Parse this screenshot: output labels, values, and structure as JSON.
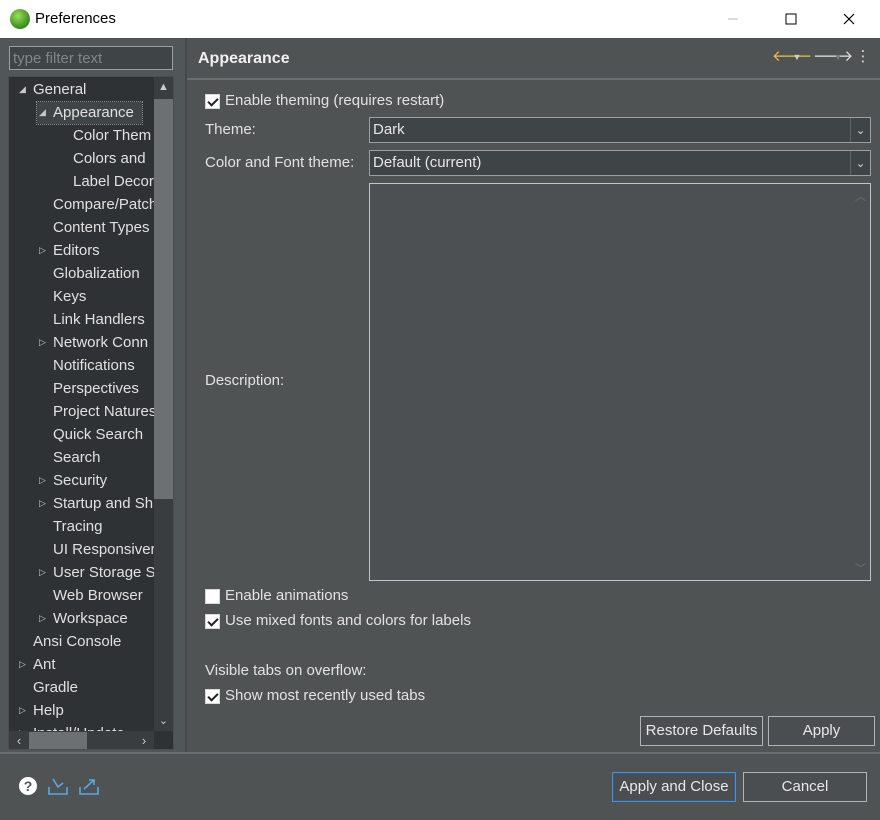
{
  "window": {
    "title": "Preferences",
    "minimize_icon": "minimize-icon",
    "maximize_icon": "maximize-icon",
    "close_icon": "close-icon"
  },
  "filter": {
    "placeholder": "type filter text",
    "value": ""
  },
  "tree": {
    "items": [
      {
        "label": "General",
        "level": 0,
        "expanded": true
      },
      {
        "label": "Appearance",
        "level": 1,
        "expanded": true,
        "selected": true
      },
      {
        "label": "Color Them",
        "level": 2
      },
      {
        "label": "Colors and",
        "level": 2
      },
      {
        "label": "Label Decor",
        "level": 2
      },
      {
        "label": "Compare/Patch",
        "level": 1
      },
      {
        "label": "Content Types",
        "level": 1
      },
      {
        "label": "Editors",
        "level": 1,
        "collapsed": true
      },
      {
        "label": "Globalization",
        "level": 1
      },
      {
        "label": "Keys",
        "level": 1
      },
      {
        "label": "Link Handlers",
        "level": 1
      },
      {
        "label": "Network Conn",
        "level": 1,
        "collapsed": true
      },
      {
        "label": "Notifications",
        "level": 1
      },
      {
        "label": "Perspectives",
        "level": 1
      },
      {
        "label": "Project Natures",
        "level": 1
      },
      {
        "label": "Quick Search",
        "level": 1
      },
      {
        "label": "Search",
        "level": 1
      },
      {
        "label": "Security",
        "level": 1,
        "collapsed": true
      },
      {
        "label": "Startup and Sh",
        "level": 1,
        "collapsed": true
      },
      {
        "label": "Tracing",
        "level": 1
      },
      {
        "label": "UI Responsiver",
        "level": 1
      },
      {
        "label": "User Storage S",
        "level": 1,
        "collapsed": true
      },
      {
        "label": "Web Browser",
        "level": 1
      },
      {
        "label": "Workspace",
        "level": 1,
        "collapsed": true
      },
      {
        "label": "Ansi Console",
        "level": 0
      },
      {
        "label": "Ant",
        "level": 0,
        "collapsed": true
      },
      {
        "label": "Gradle",
        "level": 0
      },
      {
        "label": "Help",
        "level": 0,
        "collapsed": true
      },
      {
        "label": "Install/Update",
        "level": 0,
        "collapsed": true
      }
    ]
  },
  "page": {
    "title": "Appearance",
    "back_icon": "back-arrow-icon",
    "forward_icon": "forward-arrow-icon",
    "menu_icon": "view-menu-icon"
  },
  "appearance": {
    "enable_theming": {
      "label": "Enable theming (requires restart)",
      "checked": true
    },
    "theme_label": "Theme:",
    "theme_value": "Dark",
    "color_font_label": "Color and Font theme:",
    "color_font_value": "Default (current)",
    "description_label": "Description:",
    "enable_animations": {
      "label": "Enable animations",
      "checked": false
    },
    "mixed_fonts": {
      "label": "Use mixed fonts and colors for labels",
      "checked": true
    },
    "visible_tabs_label": "Visible tabs on overflow:",
    "show_mru": {
      "label": "Show most recently used tabs",
      "checked": true
    }
  },
  "buttons": {
    "restore_defaults": "Restore Defaults",
    "apply": "Apply",
    "apply_and_close": "Apply and Close",
    "cancel": "Cancel"
  },
  "footer": {
    "help_icon": "help-icon",
    "import_icon": "import-icon",
    "export_icon": "export-icon"
  }
}
